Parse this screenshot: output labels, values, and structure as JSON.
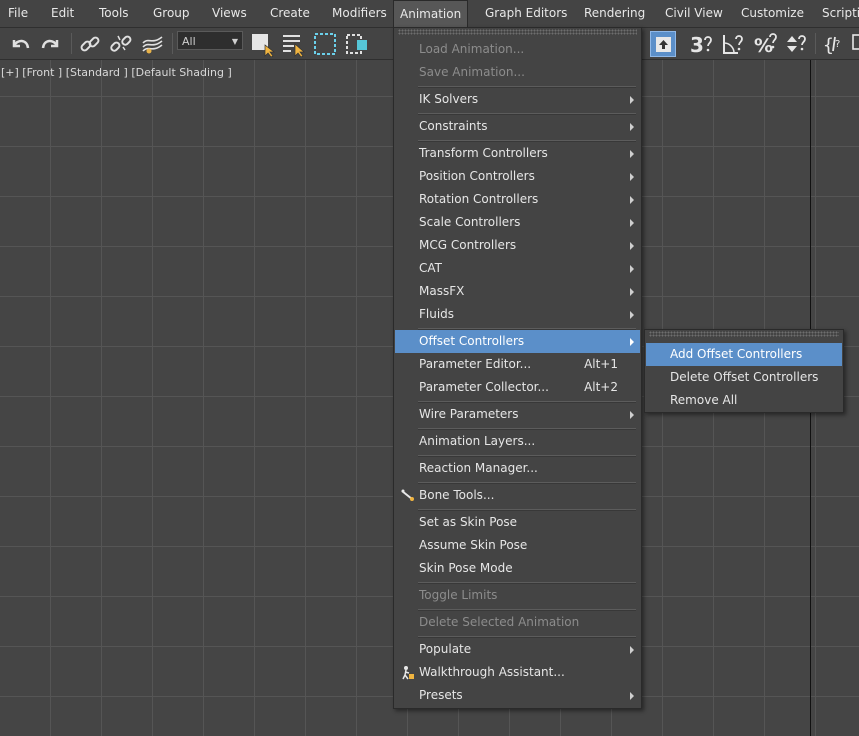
{
  "menubar": {
    "items": [
      "File",
      "Edit",
      "Tools",
      "Group",
      "Views",
      "Create",
      "Modifiers",
      "Animation",
      "Graph Editors",
      "Rendering",
      "Civil View",
      "Customize",
      "Scriptin"
    ]
  },
  "toolbar": {
    "filter_value": "All",
    "icons": [
      "undo-icon",
      "redo-icon",
      "link-icon",
      "unlink-icon",
      "bind-space-warp-icon",
      "select-object-icon",
      "select-by-name-icon",
      "rectangular-selection-icon",
      "window-crossing-icon",
      "snaps-toggle-icon",
      "angle-snap-icon",
      "percent-snap-icon",
      "spinner-snap-icon",
      "edit-named-selection-icon"
    ],
    "snap_label": "3"
  },
  "viewport": {
    "label": "[+] [Front ] [Standard ] [Default Shading ]"
  },
  "animation_menu": {
    "items": [
      {
        "label": "Load Animation...",
        "disabled": true
      },
      {
        "label": "Save Animation...",
        "disabled": true
      },
      {
        "label": "IK Solvers",
        "submenu": true
      },
      {
        "label": "Constraints",
        "submenu": true
      },
      {
        "label": "Transform Controllers",
        "submenu": true
      },
      {
        "label": "Position Controllers",
        "submenu": true
      },
      {
        "label": "Rotation Controllers",
        "submenu": true
      },
      {
        "label": "Scale Controllers",
        "submenu": true
      },
      {
        "label": "MCG Controllers",
        "submenu": true
      },
      {
        "label": "CAT",
        "submenu": true
      },
      {
        "label": "MassFX",
        "submenu": true
      },
      {
        "label": "Fluids",
        "submenu": true
      },
      {
        "label": "Offset Controllers",
        "submenu": true,
        "highlighted": true
      },
      {
        "label": "Parameter Editor...",
        "shortcut": "Alt+1"
      },
      {
        "label": "Parameter Collector...",
        "shortcut": "Alt+2"
      },
      {
        "label": "Wire Parameters",
        "submenu": true
      },
      {
        "label": "Animation Layers..."
      },
      {
        "label": "Reaction Manager..."
      },
      {
        "label": "Bone Tools..."
      },
      {
        "label": "Set as Skin Pose"
      },
      {
        "label": "Assume Skin Pose"
      },
      {
        "label": "Skin Pose Mode"
      },
      {
        "label": "Toggle Limits",
        "disabled": true
      },
      {
        "label": "Delete Selected Animation",
        "disabled": true
      },
      {
        "label": "Populate",
        "submenu": true
      },
      {
        "label": "Walkthrough Assistant..."
      },
      {
        "label": "Presets",
        "submenu": true
      }
    ]
  },
  "offset_submenu": {
    "items": [
      {
        "label": "Add Offset Controllers",
        "highlighted": true
      },
      {
        "label": "Delete Offset Controllers"
      },
      {
        "label": "Remove All"
      }
    ]
  },
  "colors": {
    "highlight": "#5b8fc9",
    "background": "#444444",
    "disabled_text": "#8c8c8c"
  }
}
